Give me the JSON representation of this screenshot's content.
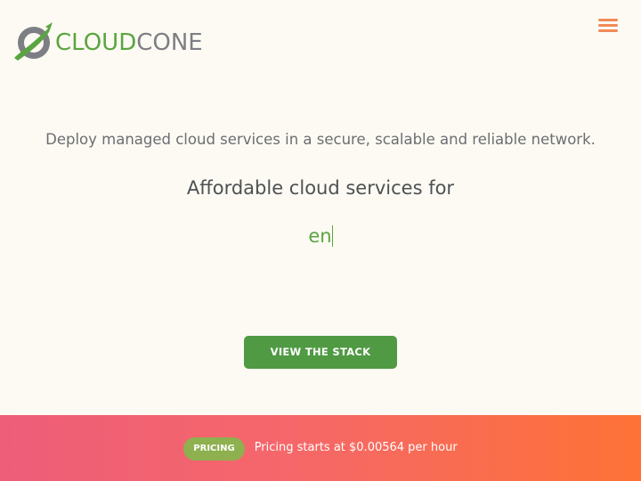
{
  "header": {
    "logo": {
      "text_part1": "CLOUD",
      "text_part2": "CONE",
      "icon": "cloudcone-logo-icon"
    },
    "menu_icon": "hamburger-menu-icon"
  },
  "hero": {
    "tagline": "Deploy managed cloud services in a secure, scalable and reliable network.",
    "headline": "Affordable cloud services for",
    "typed_text": "en",
    "cta_label": "VIEW THE STACK"
  },
  "pricing": {
    "badge": "PRICING",
    "text": "Pricing starts at $0.00564 per hour"
  },
  "colors": {
    "brand_green": "#5aa540",
    "brand_gray": "#7d7f84",
    "cta_green": "#4f9a43",
    "menu_orange": "#f08a57",
    "gradient_start": "#ee5d79",
    "gradient_end": "#fe7236",
    "badge_green": "#8eb04e",
    "background": "#fdfaf3"
  }
}
